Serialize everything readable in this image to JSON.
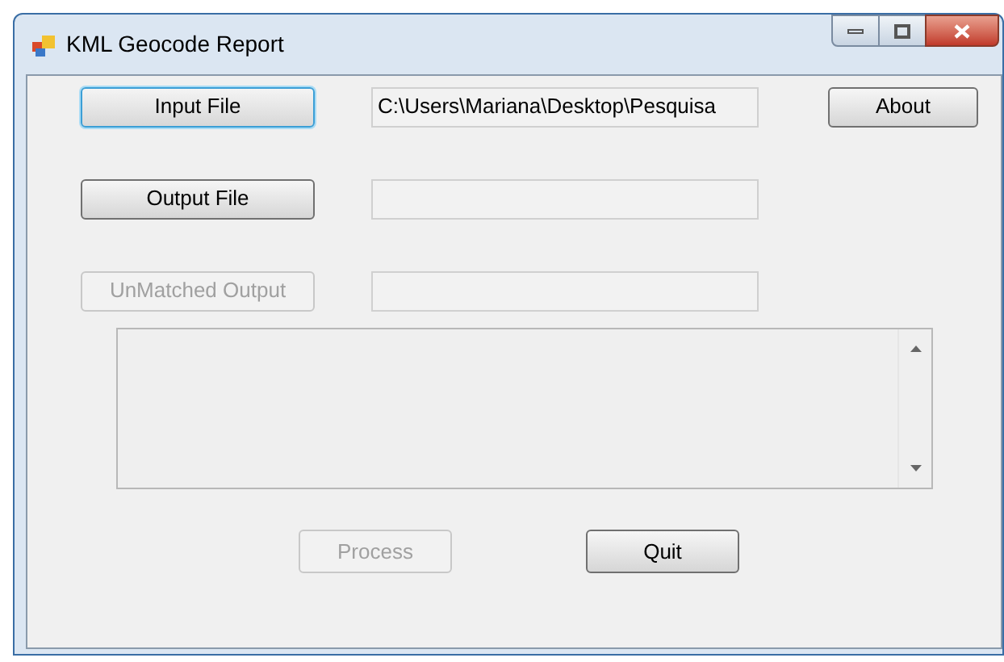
{
  "window": {
    "title": "KML Geocode Report"
  },
  "rows": [
    {
      "button": {
        "label": "Input File",
        "disabled": false,
        "focused": true
      },
      "field": {
        "value": "C:\\Users\\Mariana\\Desktop\\Pesquisa"
      }
    },
    {
      "button": {
        "label": "Output File",
        "disabled": false,
        "focused": false
      },
      "field": {}
    },
    {
      "button": {
        "label": "UnMatched Output",
        "disabled": true,
        "focused": false
      },
      "field": {}
    }
  ],
  "about_button": {
    "label": "About",
    "disabled": false
  },
  "actions": [
    {
      "label": "Process",
      "disabled": true
    },
    {
      "label": "Quit",
      "disabled": false
    }
  ]
}
